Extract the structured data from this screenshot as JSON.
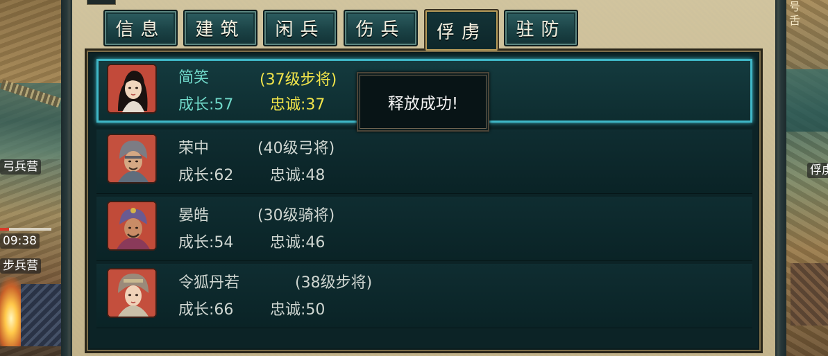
{
  "map": {
    "left_labels": [
      "弓兵营",
      "09:38",
      "步兵营"
    ],
    "right_labels": [
      "号",
      "舌",
      "俘虏"
    ],
    "timer_progress": 0.18
  },
  "tabs": [
    {
      "label": "信息",
      "active": false
    },
    {
      "label": "建筑",
      "active": false
    },
    {
      "label": "闲兵",
      "active": false
    },
    {
      "label": "伤兵",
      "active": false
    },
    {
      "label": "俘虏",
      "active": true
    },
    {
      "label": "驻防",
      "active": false
    }
  ],
  "prisoners": [
    {
      "name": "简笑",
      "level": "(37级步将)",
      "growth": "成长:57",
      "loyalty": "忠诚:37",
      "selected": true
    },
    {
      "name": "荣中",
      "level": "(40级弓将)",
      "growth": "成长:62",
      "loyalty": "忠诚:48",
      "selected": false
    },
    {
      "name": "晏皓",
      "level": "(30级骑将)",
      "growth": "成长:54",
      "loyalty": "忠诚:46",
      "selected": false
    },
    {
      "name": "令狐丹若",
      "level": "(38级步将)",
      "growth": "成长:66",
      "loyalty": "忠诚:50",
      "selected": false
    }
  ],
  "toast": {
    "message": "释放成功!"
  },
  "colors": {
    "selected_border": "#3fb7c7",
    "selected_name": "#6fd7c8",
    "selected_level": "#f1e44a",
    "panel_bg": "#0c2326",
    "frame_bg": "#d6c9a3"
  }
}
